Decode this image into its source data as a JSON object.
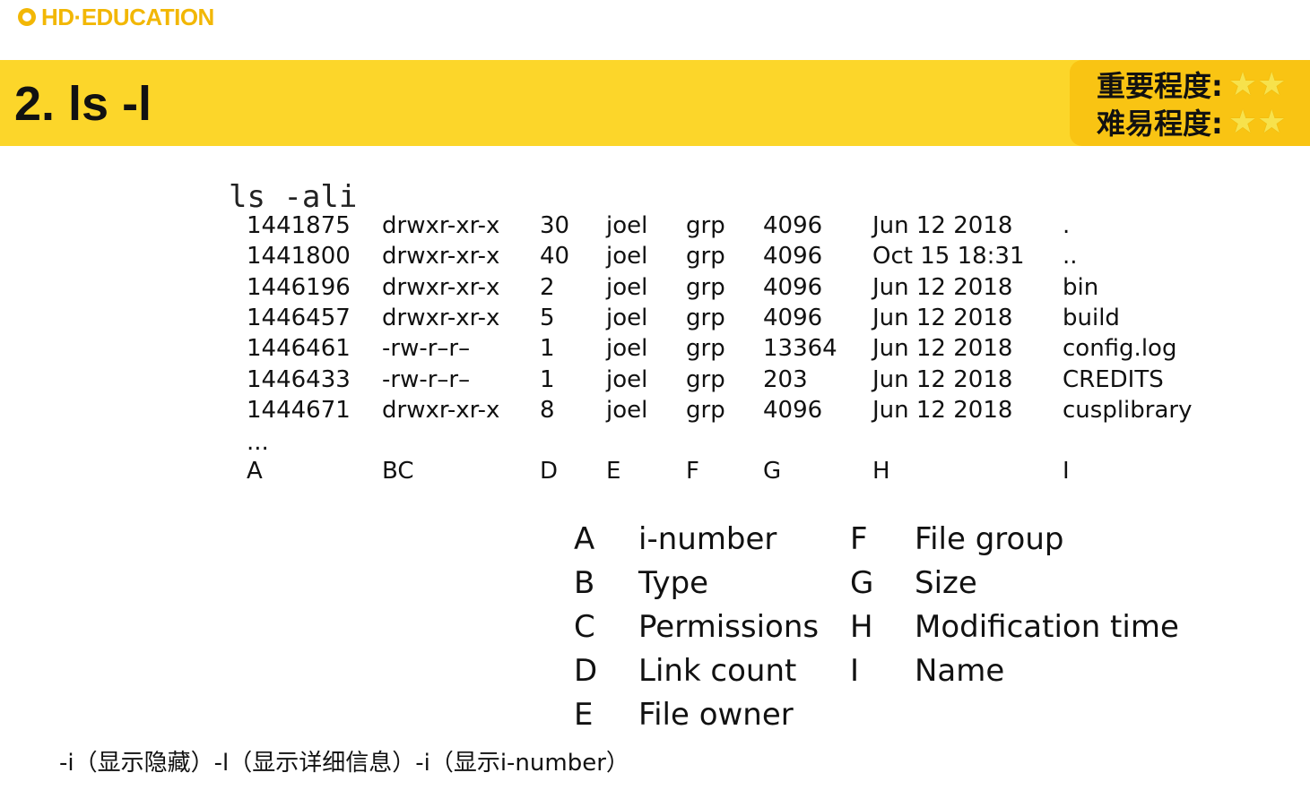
{
  "brand": {
    "name": "HD·EDUCATION",
    "accent": "#f2b705",
    "banner_color": "#fcd62a"
  },
  "slide": {
    "title": "2. ls -l"
  },
  "rating": {
    "importance_label": "重要程度:",
    "difficulty_label": "难易程度:",
    "importance_stars": "★★",
    "difficulty_stars": "★★"
  },
  "command": "ls -ali",
  "listing": {
    "rows": [
      [
        "1441875",
        "drwxr-xr-x",
        "30",
        "joel",
        "grp",
        "4096",
        "Jun 12 2018",
        "."
      ],
      [
        "1441800",
        "drwxr-xr-x",
        "40",
        "joel",
        "grp",
        "4096",
        "Oct 15 18:31",
        ".."
      ],
      [
        "1446196",
        "drwxr-xr-x",
        "2",
        "joel",
        "grp",
        "4096",
        "Jun 12 2018",
        "bin"
      ],
      [
        "1446457",
        "drwxr-xr-x",
        "5",
        "joel",
        "grp",
        "4096",
        "Jun 12 2018",
        "build"
      ],
      [
        "1446461",
        "-rw-r–r–",
        "1",
        "joel",
        "grp",
        "13364",
        "Jun 12 2018",
        "config.log"
      ],
      [
        "1446433",
        "-rw-r–r–",
        "1",
        "joel",
        "grp",
        "203",
        "Jun 12 2018",
        "CREDITS"
      ],
      [
        "1444671",
        "drwxr-xr-x",
        "8",
        "joel",
        "grp",
        "4096",
        "Jun 12 2018",
        "cusplibrary"
      ]
    ],
    "ellipsis": "...",
    "column_letters": [
      "A",
      "BC",
      "D",
      "E",
      "F",
      "G",
      "H",
      "I"
    ]
  },
  "legend": [
    {
      "letter": "A",
      "meaning": "i-number"
    },
    {
      "letter": "B",
      "meaning": "Type"
    },
    {
      "letter": "C",
      "meaning": "Permissions"
    },
    {
      "letter": "D",
      "meaning": "Link count"
    },
    {
      "letter": "E",
      "meaning": "File owner"
    },
    {
      "letter": "F",
      "meaning": "File group"
    },
    {
      "letter": "G",
      "meaning": "Size"
    },
    {
      "letter": "H",
      "meaning": "Modification time"
    },
    {
      "letter": "I",
      "meaning": "Name"
    }
  ],
  "footnote": "-i（显示隐藏）-l（显示详细信息）-i（显示i-number）"
}
